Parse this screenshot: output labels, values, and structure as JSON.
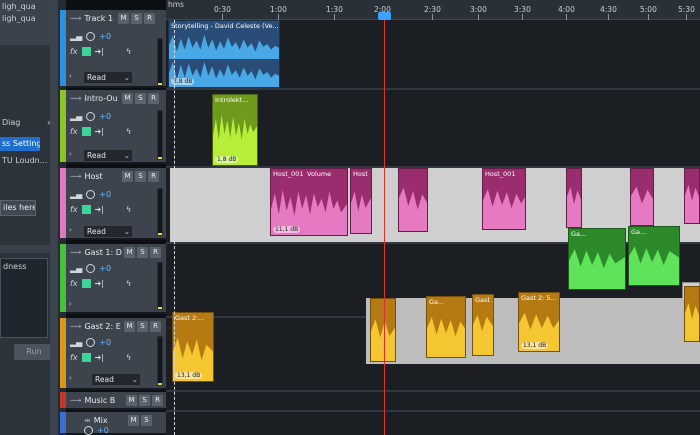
{
  "left_panel": {
    "files": [
      "ligh_qua",
      "ligh_qua"
    ],
    "diag_label": "Diag",
    "diag_arrow": "»",
    "settings_label": "ss Settings",
    "loudness_label": "TU Loudn...",
    "files_button": "iles here",
    "list_item": "dness",
    "run_button": "Run"
  },
  "ruler": {
    "ticks": [
      {
        "label": "0:30",
        "pos": "0:30"
      },
      {
        "label": "1:00",
        "pos": "1:00"
      },
      {
        "label": "1:30",
        "pos": "1:30"
      },
      {
        "label": "2:00",
        "pos": "2:00"
      },
      {
        "label": "2:30",
        "pos": "2:30"
      },
      {
        "label": "3:00",
        "pos": "3:00"
      },
      {
        "label": "3:30",
        "pos": "3:30"
      },
      {
        "label": "4:00",
        "pos": "4:00"
      },
      {
        "label": "4:30",
        "pos": "4:30"
      },
      {
        "label": "5:00",
        "pos": "5:00"
      },
      {
        "label": "5:30",
        "pos": "5:30"
      }
    ],
    "start_label": "hms"
  },
  "tracks": [
    {
      "name": "Track 1",
      "volume": "+0",
      "automation": "Read",
      "color": "#2f8fe0",
      "clip": {
        "title": "Storytelling - David Celeste (Ve...",
        "gain": "3,8 dB"
      }
    },
    {
      "name": "Intro-Ou",
      "volume": "+0",
      "automation": "Read",
      "color": "#8ac42a",
      "clip": {
        "title": "Introlekt...",
        "gain": "1,8 dB"
      }
    },
    {
      "name": "Host",
      "volume": "+0",
      "automation": "Read",
      "color": "#d63b8a",
      "clip": {
        "title": "Host_001",
        "title2": "Volume",
        "title3": "Host",
        "title4": "Host_001",
        "gain": "11,1 dB"
      }
    },
    {
      "name": "Gast 1: D",
      "volume": "+0",
      "automation": "Read",
      "color": "#47c13b",
      "clip": {
        "title": "Ga...",
        "title2": "Ga...",
        "gain": ""
      }
    },
    {
      "name": "Gast 2: E",
      "volume": "+0",
      "automation": "Read",
      "color": "#d7981c",
      "clip": {
        "title": "Gast 2:...",
        "title2": "Ga...",
        "title3": "Gast 2:",
        "title4": "Gast 2: 5...",
        "gain": "13,1 dB",
        "gain2": "13,1 dB"
      }
    },
    {
      "name": "Music B",
      "volume": "",
      "automation": "",
      "color": "#c0392b"
    },
    {
      "name": "Mix",
      "volume": "+0",
      "automation": "",
      "color": "#3b6fd1"
    }
  ],
  "buttons": {
    "m": "M",
    "s": "S",
    "r": "R"
  },
  "colors": {
    "accent": "#3ba3ff",
    "playhead": "#e0312f"
  }
}
